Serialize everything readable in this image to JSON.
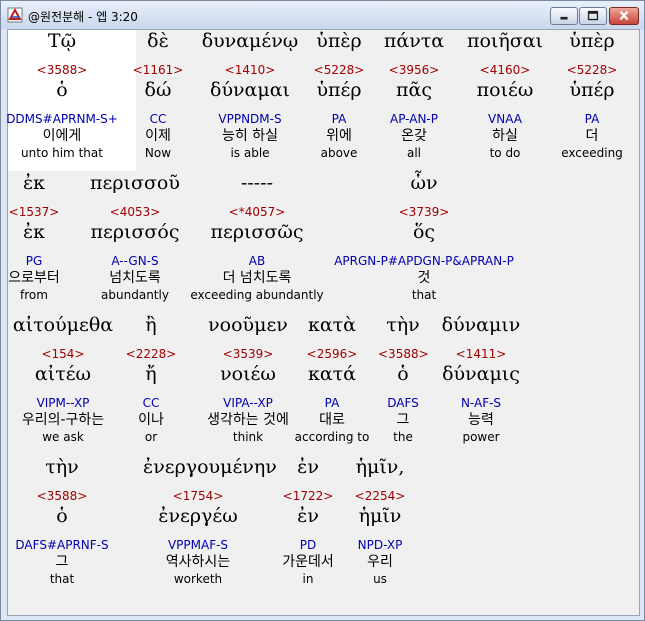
{
  "window": {
    "title": "@원전분해 - 엡 3:20",
    "minimize_symbol": "minimize",
    "maximize_symbol": "maximize",
    "close_symbol": "close"
  },
  "rows": [
    {
      "words": [
        {
          "greek": "Τῷ",
          "strongs": "<3588>",
          "lemma": "ὁ",
          "morph": "DDMS#APRNM-S+",
          "korean": "이에게",
          "english": "unto him that"
        },
        {
          "greek": "δὲ",
          "strongs": "<1161>",
          "lemma": "δώ",
          "morph": "CC",
          "korean": "이제",
          "english": "Now"
        },
        {
          "greek": "δυναμένῳ",
          "strongs": "<1410>",
          "lemma": "δύναμαι",
          "morph": "VPPNDM-S",
          "korean": "능히 하실",
          "english": "is able"
        },
        {
          "greek": "ὑπὲρ",
          "strongs": "<5228>",
          "lemma": "ὑπέρ",
          "morph": "PA",
          "korean": "위에",
          "english": "above"
        },
        {
          "greek": "πάντα",
          "strongs": "<3956>",
          "lemma": "πᾶς",
          "morph": "AP-AN-P",
          "korean": "온갖",
          "english": "all"
        },
        {
          "greek": "ποιῆσαι",
          "strongs": "<4160>",
          "lemma": "ποιέω",
          "morph": "VNAA",
          "korean": "하실",
          "english": "to do"
        },
        {
          "greek": "ὑπὲρ",
          "strongs": "<5228>",
          "lemma": "ὑπέρ",
          "morph": "PA",
          "korean": "더",
          "english": "exceeding"
        }
      ]
    },
    {
      "words": [
        {
          "greek": "ἐκ",
          "strongs": "<1537>",
          "lemma": "ἐκ",
          "morph": "PG",
          "korean": "으로부터",
          "english": "from"
        },
        {
          "greek": "περισσοῦ",
          "strongs": "<4053>",
          "lemma": "περισσός",
          "morph": "A--GN-S",
          "korean": "넘치도록",
          "english": "abundantly"
        },
        {
          "greek": "-----",
          "strongs": "<*4057>",
          "lemma": "περισσῶς",
          "morph": "AB",
          "korean": "더 넘치도록",
          "english": "exceeding abundantly"
        },
        {
          "greek": "ὧν",
          "strongs": "<3739>",
          "lemma": "ὅς",
          "morph": "APRGN-P#APDGN-P&APRAN-P",
          "korean": "것",
          "english": "that"
        }
      ]
    },
    {
      "words": [
        {
          "greek": "αἰτούμεθα",
          "strongs": "<154>",
          "lemma": "αἰτέω",
          "morph": "VIPM--XP",
          "korean": "우리의-구하는",
          "english": "we ask"
        },
        {
          "greek": "ἢ",
          "strongs": "<2228>",
          "lemma": "ἤ",
          "morph": "CC",
          "korean": "이나",
          "english": "or"
        },
        {
          "greek": "νοοῦμεν",
          "strongs": "<3539>",
          "lemma": "νοιέω",
          "morph": "VIPA--XP",
          "korean": "생각하는 것에",
          "english": "think"
        },
        {
          "greek": "κατὰ",
          "strongs": "<2596>",
          "lemma": "κατά",
          "morph": "PA",
          "korean": "대로",
          "english": "according to"
        },
        {
          "greek": "τὴν",
          "strongs": "<3588>",
          "lemma": "ὁ",
          "morph": "DAFS",
          "korean": "그",
          "english": "the"
        },
        {
          "greek": "δύναμιν",
          "strongs": "<1411>",
          "lemma": "δύναμις",
          "morph": "N-AF-S",
          "korean": "능력",
          "english": "power"
        }
      ]
    },
    {
      "words": [
        {
          "greek": "τὴν",
          "strongs": "<3588>",
          "lemma": "ὁ",
          "morph": "DAFS#APRNF-S",
          "korean": "그",
          "english": "that"
        },
        {
          "greek": "ἐνεργουμένην",
          "strongs": "<1754>",
          "lemma": "ἐνεργέω",
          "morph": "VPPMAF-S",
          "korean": "역사하시는",
          "english": "worketh"
        },
        {
          "greek": "ἐν",
          "strongs": "<1722>",
          "lemma": "ἐν",
          "morph": "PD",
          "korean": "가운데서",
          "english": "in"
        },
        {
          "greek": "ἡμῖν,",
          "strongs": "<2254>",
          "lemma": "ἡμῖν",
          "morph": "NPD-XP",
          "korean": "우리",
          "english": "us"
        }
      ]
    }
  ]
}
